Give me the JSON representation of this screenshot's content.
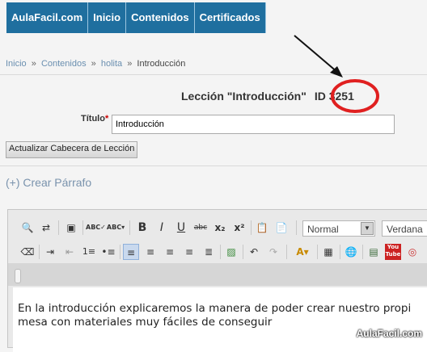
{
  "nav": {
    "items": [
      "AulaFacil.com",
      "Inicio",
      "Contenidos",
      "Certificados"
    ]
  },
  "breadcrumb": {
    "items": [
      "Inicio",
      "Contenidos",
      "holita"
    ],
    "separator": "»",
    "current": "Introducción"
  },
  "lesson": {
    "heading": "Lección \"Introducción\"",
    "id_label": "ID",
    "id_value": "3251"
  },
  "form": {
    "title_label": "Título",
    "required_mark": "*",
    "title_value": "Introducción",
    "update_button": "Actualizar Cabecera de Lección"
  },
  "create_paragraph": "(+) Crear Párrafo",
  "editor": {
    "format_combo": "Normal",
    "font_combo": "Verdana",
    "content": "En la introducción explicaremos la manera de poder crear nuestro propi mesa con materiales muy fáciles de conseguir",
    "icons_row1": [
      "find-icon",
      "replace-icon",
      "select-all-icon",
      "spellcheck-icon",
      "spellcheck-dropdown-icon",
      "bold-icon",
      "italic-icon",
      "underline-icon",
      "strikethrough-icon",
      "subscript-icon",
      "superscript-icon",
      "paste-text-icon",
      "paste-word-icon"
    ],
    "icons_row2": [
      "eraser-icon",
      "indent-icon",
      "outdent-icon",
      "numbered-list-icon",
      "bullet-list-icon",
      "align-left-icon",
      "align-center-icon",
      "align-right-icon",
      "justify-icon",
      "justify-full-icon",
      "image-icon",
      "undo-icon",
      "redo-icon",
      "text-color-icon",
      "table-icon",
      "globe-link-icon",
      "save-icon",
      "youtube-icon",
      "settings-icon"
    ]
  },
  "colors": {
    "nav_bg": "#1f6f9f",
    "annotation_circle": "#e02020"
  },
  "watermark": "AulaFacil.com"
}
